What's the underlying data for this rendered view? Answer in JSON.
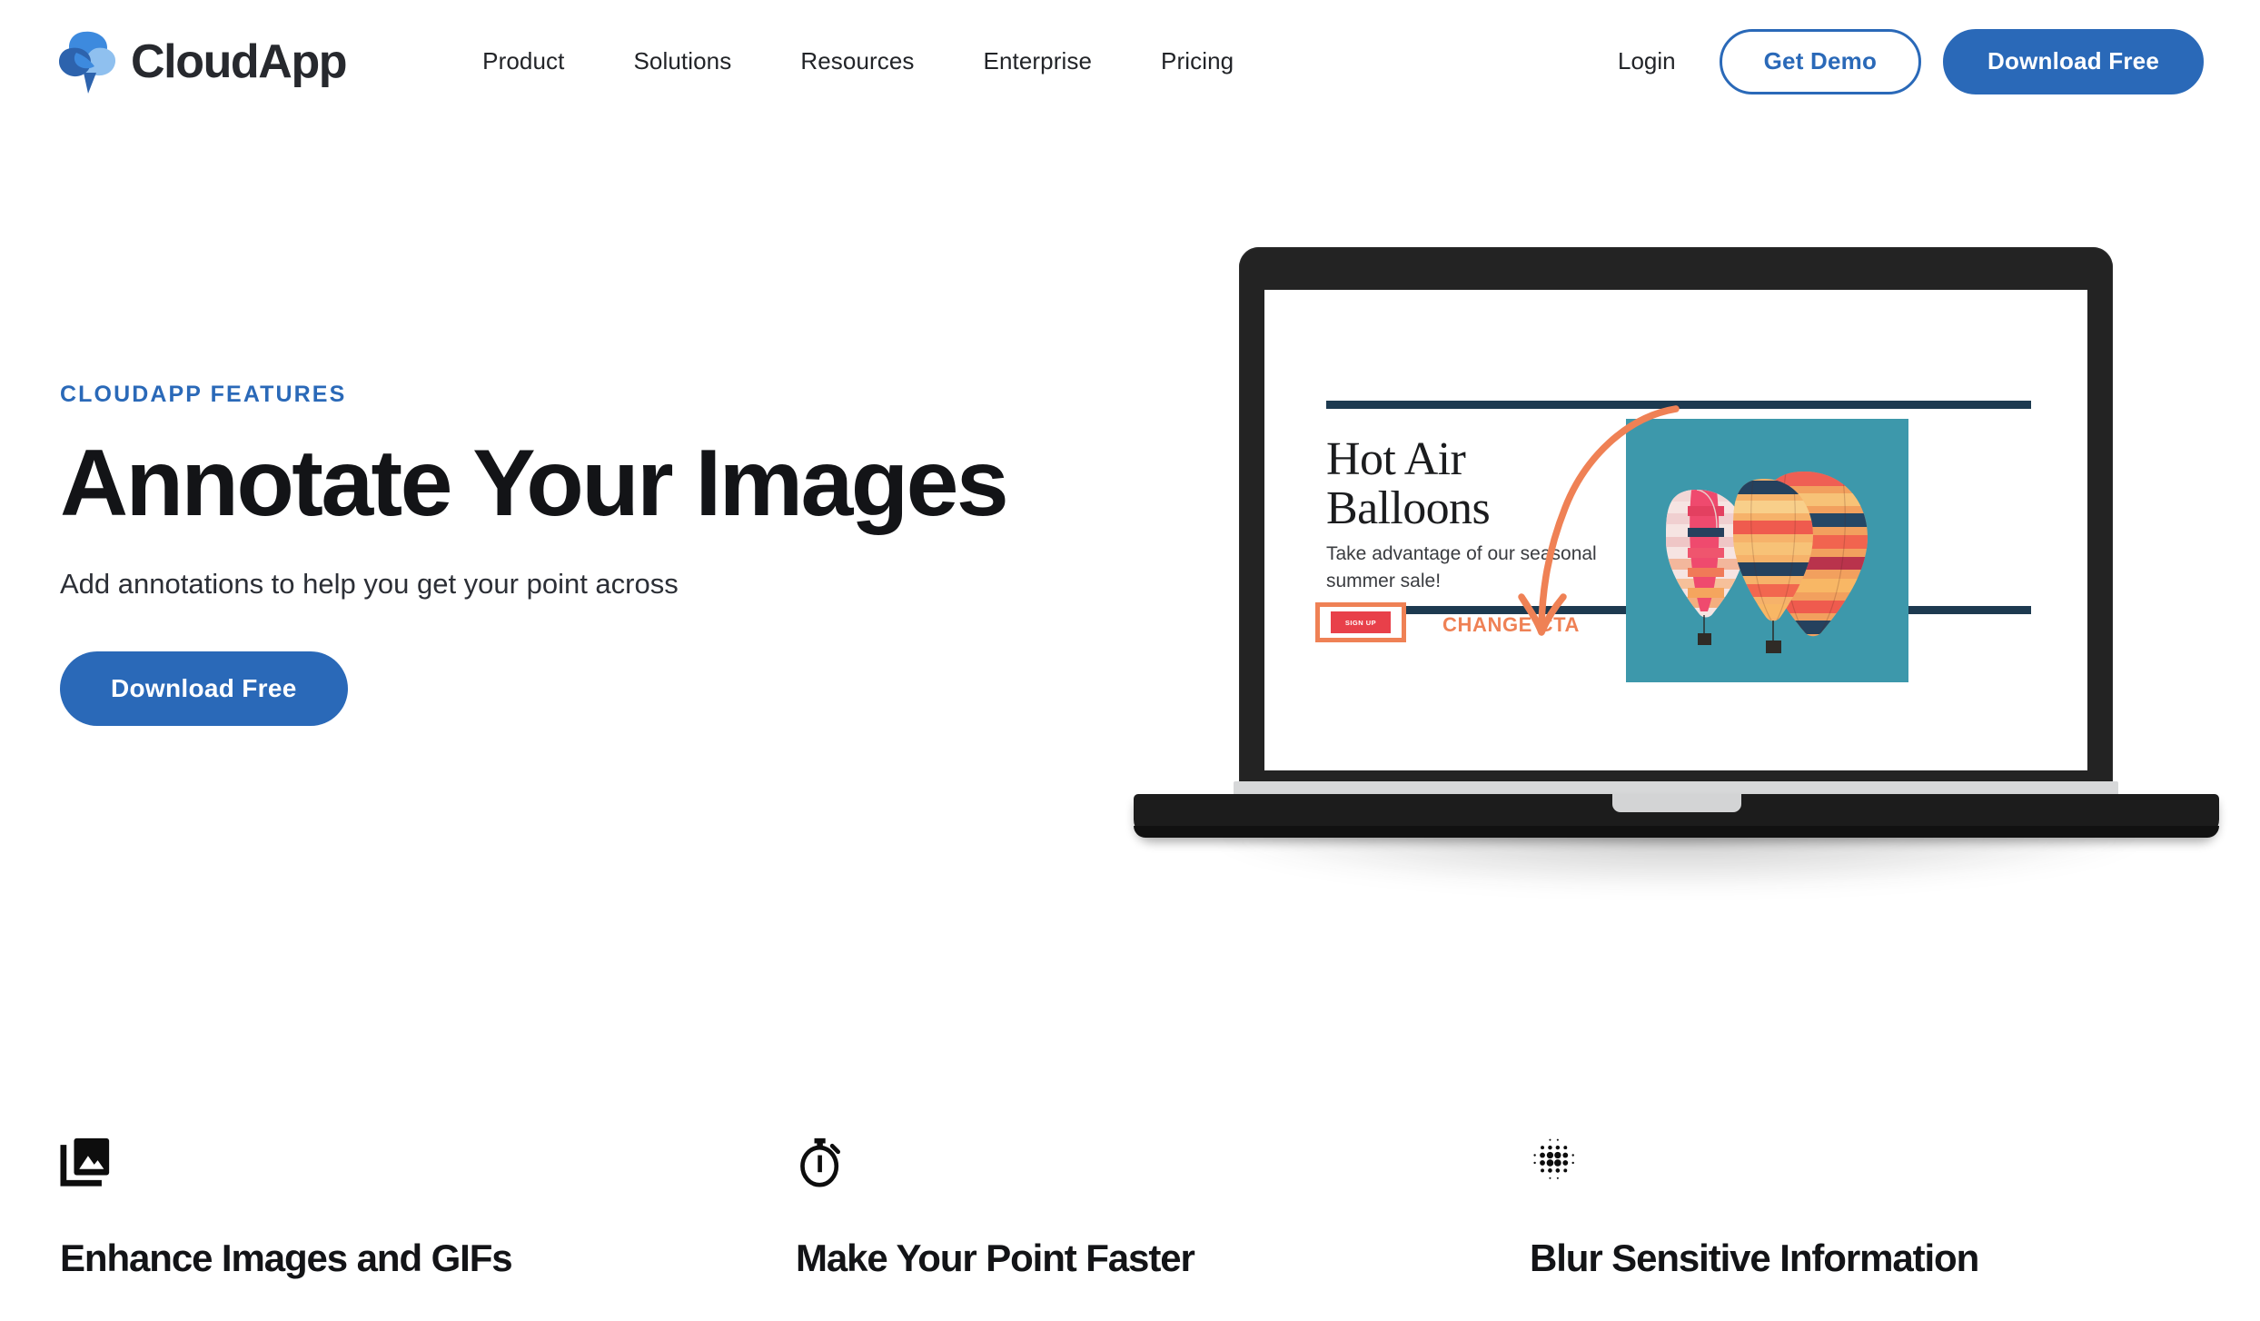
{
  "header": {
    "logo_text": "CloudApp",
    "logo_icon": "cloudapp-logo-icon",
    "nav_items": [
      {
        "label": "Product"
      },
      {
        "label": "Solutions"
      },
      {
        "label": "Resources"
      },
      {
        "label": "Enterprise"
      },
      {
        "label": "Pricing"
      }
    ],
    "login_label": "Login",
    "demo_label": "Get Demo",
    "download_label": "Download Free"
  },
  "hero": {
    "eyebrow": "CLOUDAPP FEATURES",
    "title": "Annotate Your Images",
    "subtitle": "Add annotations to help you get your point across",
    "cta_label": "Download Free"
  },
  "laptop_slide": {
    "heading": "Hot Air Balloons",
    "body": "Take advantage of our seasonal summer sale!",
    "signup_label": "SIGN UP",
    "annotation_label": "CHANGE CTA",
    "photo_alt": "hot-air-balloons-photo",
    "arrow_alt": "curved-annotation-arrow"
  },
  "features": [
    {
      "icon": "photo-library-icon",
      "title": "Enhance Images and GIFs"
    },
    {
      "icon": "stopwatch-icon",
      "title": "Make Your Point Faster"
    },
    {
      "icon": "blur-dots-icon",
      "title": "Blur Sensitive Information"
    }
  ],
  "colors": {
    "brand_blue": "#2a69b8",
    "logo_dark_blue": "#2d63ad",
    "logo_mid_blue": "#3d8ade",
    "logo_light_blue": "#8fc0ef",
    "text_dark": "#131417",
    "annotation_orange": "#ef8155",
    "cta_red": "#e8404a",
    "slide_navy": "#1d3a50",
    "photo_teal": "#3d98ab",
    "laptop_body": "#232323"
  }
}
